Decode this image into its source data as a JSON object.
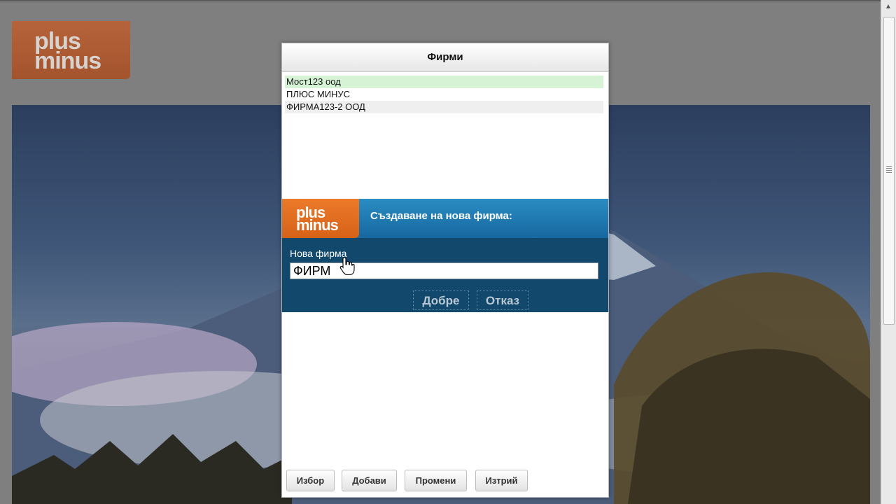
{
  "background_page": {
    "logo": {
      "line1": "plus",
      "line2": "minus"
    }
  },
  "dialog": {
    "title": "Фирми",
    "companies": [
      {
        "name": "Мост123 оод",
        "state": "selected"
      },
      {
        "name": "ПЛЮС МИНУС",
        "state": "normal"
      },
      {
        "name": "ФИРМА123-2 ООД",
        "state": "alternate"
      }
    ],
    "create_panel": {
      "logo": {
        "line1": "plus",
        "line2": "minus"
      },
      "title": "Създаване на нова фирма:",
      "field_label": "Нова фирма",
      "field_value": "ФИРМ",
      "ok_label": "Добре",
      "cancel_label": "Отказ"
    },
    "buttons": {
      "select_label": "Избор",
      "add_label": "Добави",
      "edit_label": "Промени",
      "delete_label": "Изтрий"
    }
  },
  "colors": {
    "overlay_gray": "#7f7f7f",
    "panel_blue": "#1767a0",
    "panel_dark": "#11486b",
    "logo_orange": "#e06a20",
    "selected_row": "#d6f3d6"
  }
}
